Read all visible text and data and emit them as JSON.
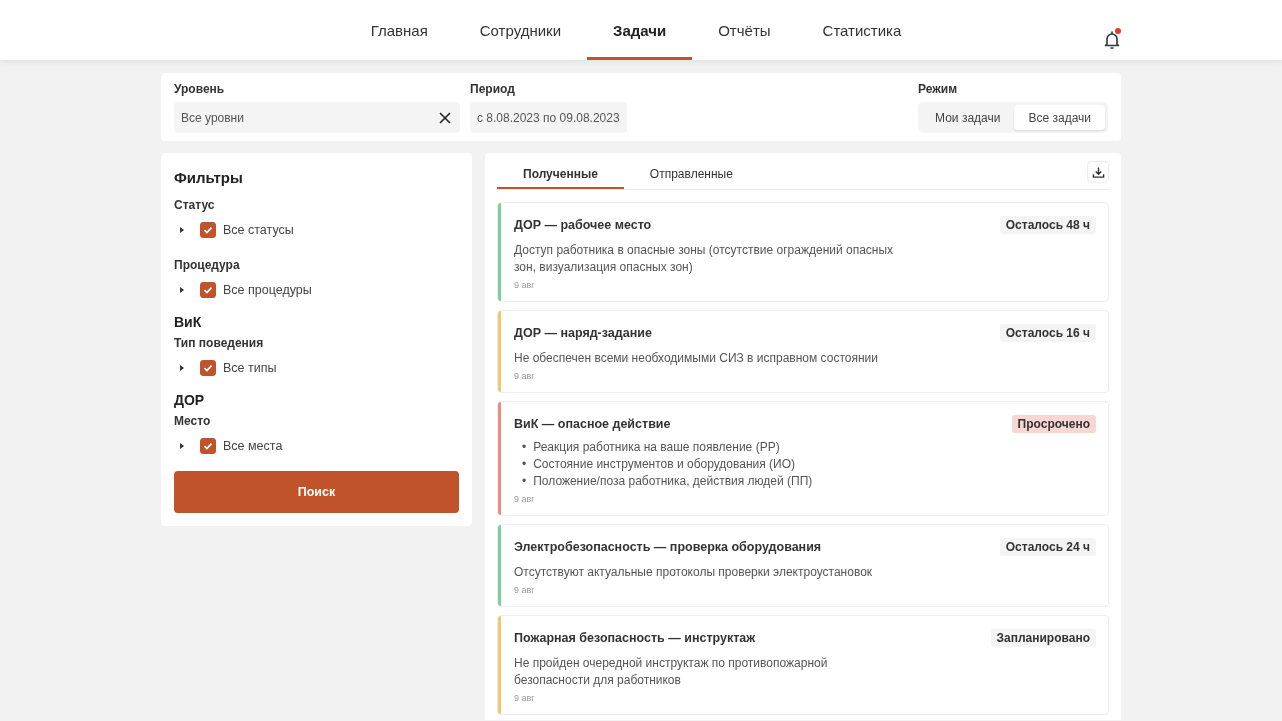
{
  "nav": {
    "items": [
      {
        "label": "Главная",
        "selected": false
      },
      {
        "label": "Сотрудники",
        "selected": false
      },
      {
        "label": "Задачи",
        "selected": true
      },
      {
        "label": "Отчёты",
        "selected": false
      },
      {
        "label": "Статистика",
        "selected": false
      }
    ],
    "notifications": {
      "unread": true
    }
  },
  "toolbar": {
    "level": {
      "label": "Уровень",
      "value": "Все уровни"
    },
    "period": {
      "label": "Период",
      "value": "с 8.08.2023 по 09.08.2023"
    },
    "mode": {
      "label": "Режим",
      "options": [
        {
          "label": "Мои задачи",
          "selected": false
        },
        {
          "label": "Все задачи",
          "selected": true
        }
      ]
    }
  },
  "filters": {
    "title": "Фильтры",
    "groups": [
      {
        "kind": "field",
        "label": "Статус",
        "option": {
          "label": "Все статусы",
          "checked": true,
          "expanded": false
        }
      },
      {
        "kind": "field",
        "label": "Процедура",
        "option": {
          "label": "Все процедуры",
          "checked": true,
          "expanded": false
        }
      },
      {
        "kind": "section",
        "label": "ВиК"
      },
      {
        "kind": "field",
        "label": "Тип поведения",
        "option": {
          "label": "Все типы",
          "checked": true,
          "expanded": false
        }
      },
      {
        "kind": "section",
        "label": "ДОР"
      },
      {
        "kind": "field",
        "label": "Место",
        "option": {
          "label": "Все места",
          "checked": true,
          "expanded": false
        }
      }
    ],
    "search_button": "Поиск"
  },
  "tasks": {
    "tabs": [
      {
        "label": "Полученные",
        "selected": true
      },
      {
        "label": "Отправленные",
        "selected": false
      }
    ],
    "cards": [
      {
        "title": "ДОР — рабочее место",
        "color": "#7ecf9a",
        "badge": {
          "text": "Осталось 48 ч",
          "kind": "neutral"
        },
        "description": "Доступ работника в опасные зоны (отсутствие ограждений опасных зон, визуализация опасных зон)",
        "date": "9 авг"
      },
      {
        "title": "ДОР — наряд-задание",
        "color": "#f5c46f",
        "badge": {
          "text": "Осталось 16 ч",
          "kind": "neutral"
        },
        "description": "Не обеспечен всеми необходимыми СИЗ в исправном состоянии",
        "date": "9 авг"
      },
      {
        "title": "ВиК — опасное действие",
        "color": "#ee8b80",
        "badge": {
          "text": "Просрочено",
          "kind": "overdue"
        },
        "bullets": {
          "marker": "•",
          "items": [
            "Реакция работника на ваше появление (РР)",
            "Состояние инструментов и оборудования (ИО)",
            "Положение/поза работника, действия людей (ПП)"
          ]
        },
        "date": "9 авг"
      },
      {
        "title": "Электробезопасность — проверка оборудования",
        "color": "#7ecf9a",
        "badge": {
          "text": "Осталось 24 ч",
          "kind": "neutral"
        },
        "description": "Отсутствуют актуальные протоколы проверки электроустановок",
        "date": "9 авг"
      },
      {
        "title": "Пожарная безопасность — инструктаж",
        "color": "#f5c46f",
        "badge": {
          "text": "Запланировано",
          "kind": "neutral"
        },
        "description": "Не пройден очередной инструктаж по противопожарной безопасности для работников",
        "date": "9 авг"
      }
    ]
  }
}
